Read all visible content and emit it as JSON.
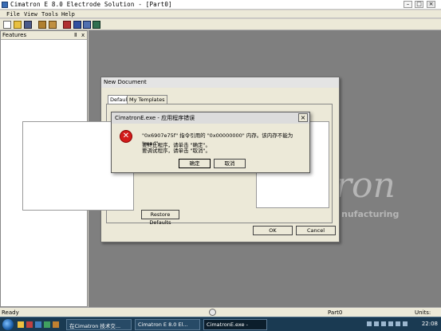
{
  "window": {
    "title": "Cimatron E 8.0 Electrode Solution - [Part0]"
  },
  "menu": [
    "File",
    "View",
    "Tools",
    "Help"
  ],
  "features_panel": {
    "title": "Features",
    "pin": "Ⅱ",
    "close": "x"
  },
  "watermark": {
    "logo": "ron",
    "tagline": "nufacturing"
  },
  "new_document": {
    "title": "New Document",
    "tabs": [
      "Default",
      "My Templates"
    ],
    "restore_defaults": "Restore Defaults",
    "ok": "OK",
    "cancel": "Cancel"
  },
  "error_dialog": {
    "title": "CimatronE.exe - 应用程序错误",
    "message": "\"0x6907e75f\" 指令引用的 \"0x00000000\" 内存。该内存不能为 \"read\"。",
    "line2": "要终止程序，请单击 \"确定\"。",
    "line3": "要调试程序，请单击 \"取消\"。",
    "ok": "确定",
    "cancel": "取消"
  },
  "status": {
    "left": "Ready",
    "part": "Part0",
    "units": "Units: mm"
  },
  "taskbar": {
    "items": [
      "在Cimatron 技术交...",
      "Cimatron E 8.0 El...",
      "CimatronE.exe -"
    ],
    "clock": "22:08"
  },
  "colors": {
    "error_red": "#d21b1b",
    "workspace": "#7f7f7f",
    "taskbar": "#1a3a52"
  }
}
